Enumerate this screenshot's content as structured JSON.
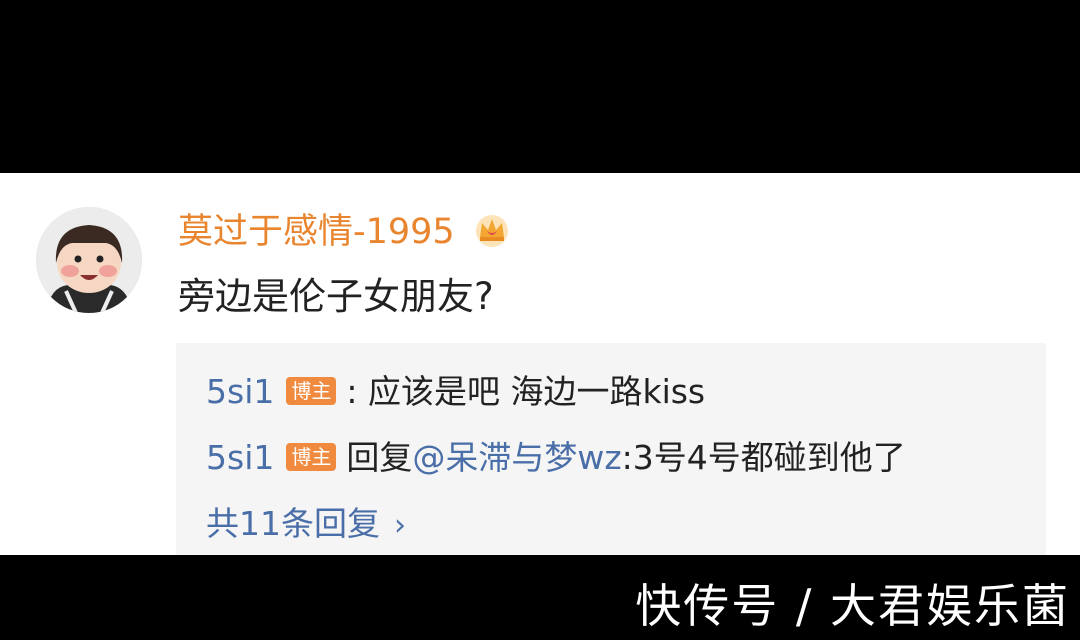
{
  "comment": {
    "username": "莫过于感情-1995",
    "text": "旁边是伦子女朋友?"
  },
  "replies": [
    {
      "user": "5si1",
      "badge": "博主",
      "separator": ":",
      "text": " 应该是吧 海边一路kiss"
    },
    {
      "user": "5si1",
      "badge": "博主",
      "prefix": "回复",
      "mention": "@呆滞与梦wz",
      "text": ":3号4号都碰到他了"
    }
  ],
  "more_replies": {
    "label": "共11条回复",
    "icon": "chevron-right-icon",
    "glyph": "›"
  },
  "icons": {
    "avatar": "child-avatar",
    "crown": "crown-icon"
  },
  "colors": {
    "username": "#e8852e",
    "link": "#4a6ea8",
    "badge": "#f08a3e",
    "reply_bg": "#f5f5f5"
  },
  "watermark": "快传号 / 大君娱乐菌"
}
